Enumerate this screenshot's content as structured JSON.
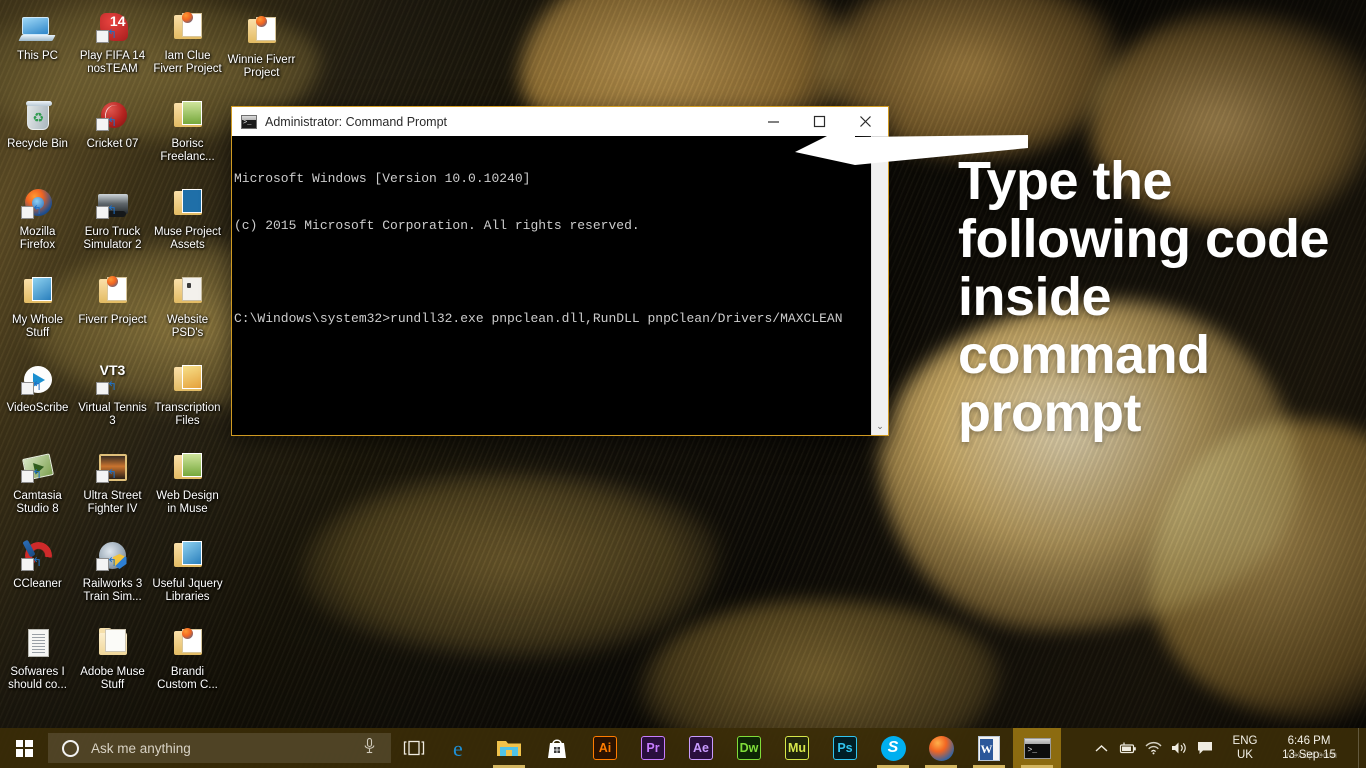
{
  "desktop": {
    "icons": [
      {
        "label": "This PC",
        "icon": "this-pc-icon",
        "shortcut": false
      },
      {
        "label": "Play FIFA 14 nosTEAM",
        "icon": "fifa-14-icon",
        "shortcut": true
      },
      {
        "label": "Iam Clue Fiverr Project",
        "icon": "folder-firefox-icon",
        "shortcut": false
      },
      {
        "label": "Winnie Fiverr Project",
        "icon": "folder-firefox-icon",
        "shortcut": false
      },
      {
        "label": "Recycle Bin",
        "icon": "recycle-bin-icon",
        "shortcut": false
      },
      {
        "label": "Cricket 07",
        "icon": "cricket-ball-icon",
        "shortcut": true
      },
      {
        "label": "Borisc Freelanc...",
        "icon": "folder-green-icon",
        "shortcut": false
      },
      {
        "label": "Mozilla Firefox",
        "icon": "firefox-icon",
        "shortcut": true
      },
      {
        "label": "Euro Truck Simulator 2",
        "icon": "truck-icon",
        "shortcut": true
      },
      {
        "label": "Muse Project Assets",
        "icon": "folder-muse-icon",
        "shortcut": false
      },
      {
        "label": "My Whole Stuff",
        "icon": "folder-image-icon",
        "shortcut": false
      },
      {
        "label": "Fiverr Project",
        "icon": "folder-firefox-icon",
        "shortcut": false
      },
      {
        "label": "Website PSD's",
        "icon": "folder-dark-icon",
        "shortcut": false
      },
      {
        "label": "VideoScribe",
        "icon": "videoscribe-icon",
        "shortcut": true
      },
      {
        "label": "Virtual Tennis 3",
        "icon": "vt3-icon",
        "shortcut": true
      },
      {
        "label": "Transcription Files",
        "icon": "folder-yellow-image-icon",
        "shortcut": false
      },
      {
        "label": "Camtasia Studio 8",
        "icon": "camtasia-icon",
        "shortcut": true
      },
      {
        "label": "Ultra Street Fighter IV",
        "icon": "street-fighter-icon",
        "shortcut": true
      },
      {
        "label": "Web Design in Muse",
        "icon": "folder-green-icon",
        "shortcut": false
      },
      {
        "label": "CCleaner",
        "icon": "ccleaner-icon",
        "shortcut": true
      },
      {
        "label": "Railworks 3 Train Sim...",
        "icon": "railworks-icon",
        "shortcut": true
      },
      {
        "label": "Useful Jquery Libraries",
        "icon": "folder-image-icon",
        "shortcut": false
      },
      {
        "label": "Sofwares I should co...",
        "icon": "text-document-icon",
        "shortcut": false
      },
      {
        "label": "Adobe Muse Stuff",
        "icon": "folder-plain-icon",
        "shortcut": false
      },
      {
        "label": "Brandi Custom C...",
        "icon": "folder-firefox-icon",
        "shortcut": false
      }
    ],
    "hidden_column_icons": [
      {
        "label": "",
        "icon": "folder-icon"
      },
      {
        "label": "",
        "icon": "folder-icon"
      }
    ]
  },
  "cmd_window": {
    "title": "Administrator: Command Prompt",
    "icon": "console-icon",
    "minimize_label": "—",
    "maximize_label": "☐",
    "close_label": "✕",
    "lines": [
      "Microsoft Windows [Version 10.0.10240]",
      "(c) 2015 Microsoft Corporation. All rights reserved.",
      "",
      "C:\\Windows\\system32>rundll32.exe pnpclean.dll,RunDLL pnpClean/Drivers/MAXCLEAN"
    ],
    "scrollbar": {
      "down_arrow": "⌄"
    }
  },
  "annotation": {
    "text": "Type the following code inside command prompt",
    "arrow": "left-arrow-annotation",
    "color": "#ffffff"
  },
  "taskbar": {
    "start": {
      "name": "start-button",
      "icon": "windows-logo-icon"
    },
    "search": {
      "placeholder": "Ask me anything",
      "cortana_icon": "cortana-ring-icon",
      "mic_icon": "microphone-icon"
    },
    "task_view": {
      "icon": "task-view-icon"
    },
    "pinned": [
      {
        "name": "microsoft-edge",
        "icon": "edge-icon",
        "glyph": "e",
        "color": "#1e8fd5",
        "running": false
      },
      {
        "name": "file-explorer",
        "icon": "file-explorer-icon",
        "glyph": "",
        "color": "#f0c24b",
        "running": true
      },
      {
        "name": "microsoft-store",
        "icon": "store-icon",
        "glyph": "",
        "color": "#ffffff",
        "running": false
      },
      {
        "name": "adobe-illustrator",
        "icon": "illustrator-icon",
        "glyph": "Ai",
        "color": "#ff7c00",
        "running": false
      },
      {
        "name": "adobe-premiere",
        "icon": "premiere-icon",
        "glyph": "Pr",
        "color": "#c77dff",
        "running": false
      },
      {
        "name": "adobe-after-effects",
        "icon": "after-effects-icon",
        "glyph": "Ae",
        "color": "#c99bff",
        "running": false
      },
      {
        "name": "adobe-dreamweaver",
        "icon": "dreamweaver-icon",
        "glyph": "Dw",
        "color": "#7fdd39",
        "running": false
      },
      {
        "name": "adobe-muse",
        "icon": "muse-icon",
        "glyph": "Mu",
        "color": "#d6e64a",
        "running": false
      },
      {
        "name": "adobe-photoshop",
        "icon": "photoshop-icon",
        "glyph": "Ps",
        "color": "#31c5f0",
        "running": false
      },
      {
        "name": "skype",
        "icon": "skype-icon",
        "glyph": "S",
        "color": "#00aff0",
        "running": true
      },
      {
        "name": "mozilla-firefox",
        "icon": "firefox-icon",
        "glyph": "",
        "color": "#f26522",
        "running": true
      },
      {
        "name": "microsoft-word",
        "icon": "word-icon",
        "glyph": "W",
        "color": "#2b579a",
        "running": true
      },
      {
        "name": "command-prompt",
        "icon": "console-icon",
        "glyph": "",
        "color": "#1b1b1b",
        "running": true,
        "active": true
      }
    ],
    "tray": {
      "show_hidden": "chevron-up-icon",
      "battery": "battery-icon",
      "network": "wifi-icon",
      "volume": "speaker-icon",
      "action_center": "action-center-icon",
      "language_line1": "ENG",
      "language_line2": "UK",
      "time": "6:46 PM",
      "date": "13-Sep-15",
      "watermark": "wsxdp.com"
    }
  },
  "colors": {
    "taskbar": "#3a2c08",
    "cmd_border": "#d09a22",
    "cmd_bg": "#000000",
    "titlebar": "#ffffff",
    "annotation": "#ffffff",
    "active_task_highlight": "#d4a017"
  }
}
